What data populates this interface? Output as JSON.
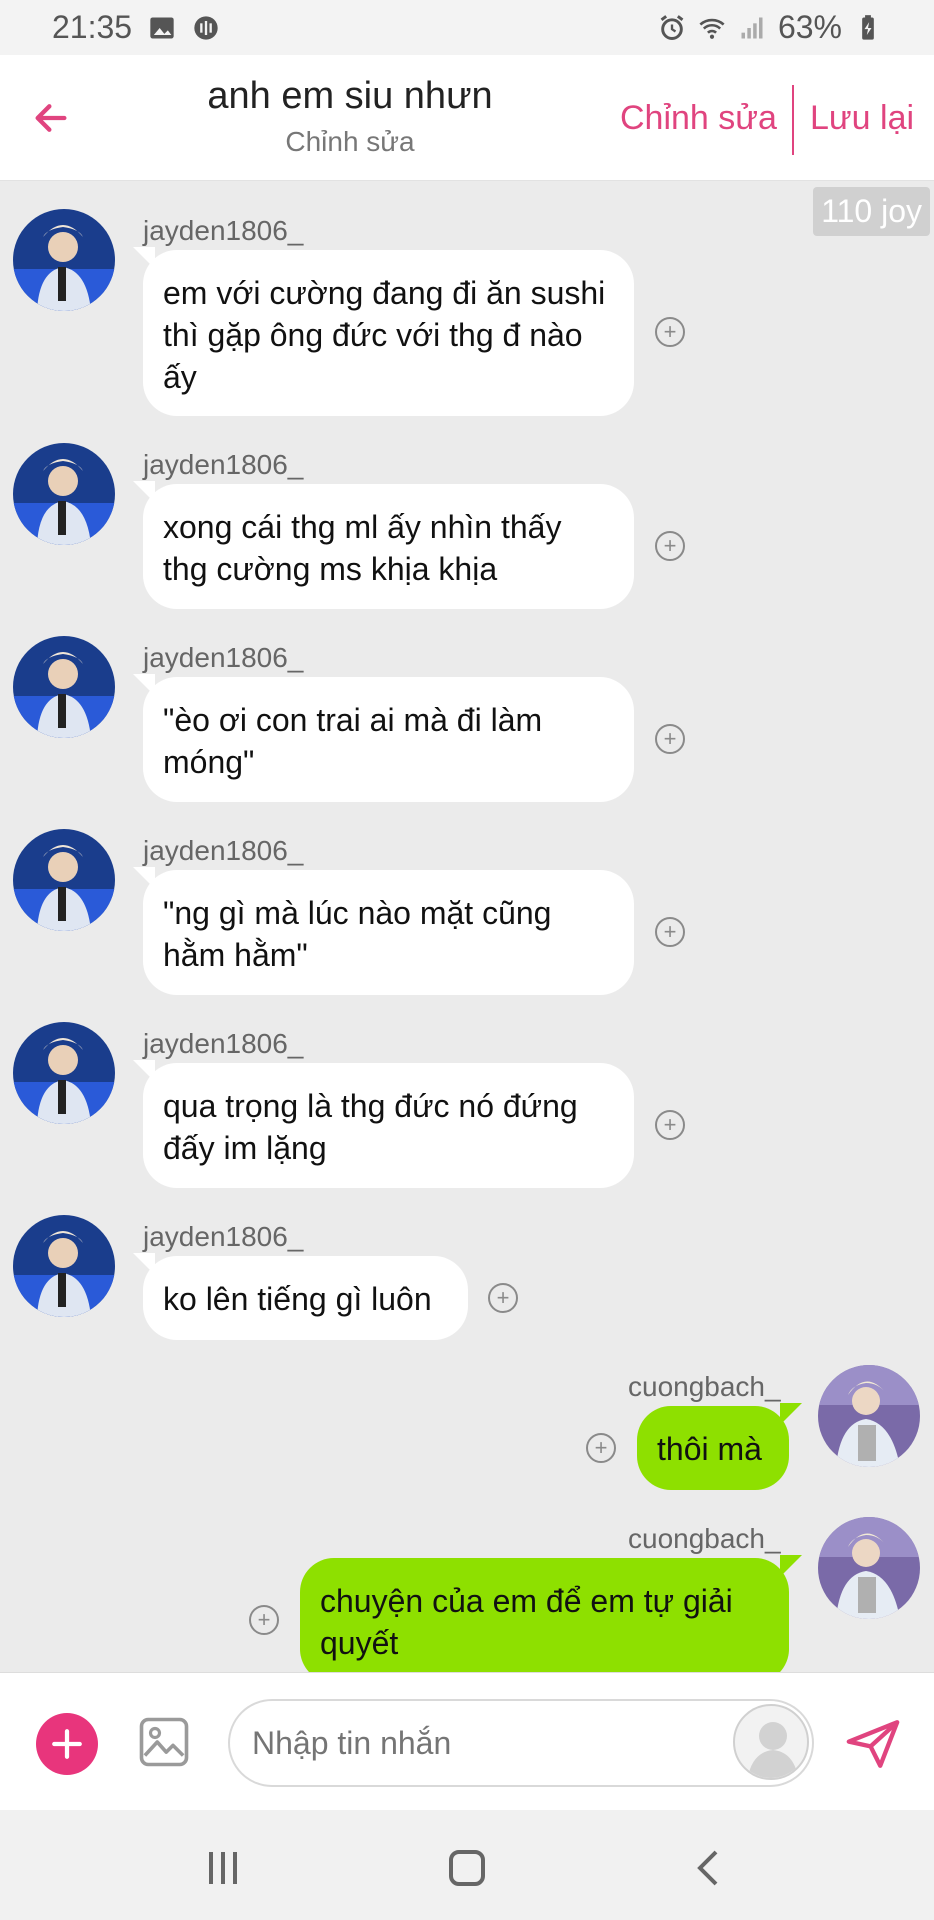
{
  "status_bar": {
    "time": "21:35",
    "battery": "63%"
  },
  "header": {
    "title": "anh em siu nhưn",
    "subtitle": "Chỉnh sửa",
    "edit_label": "Chỉnh sửa",
    "save_label": "Lưu lại"
  },
  "chat": {
    "joy_badge": "110 joy",
    "messages": [
      {
        "user": "jayden1806_",
        "text": "em với cường đang đi ăn sushi thì gặp ông đức với thg đ nào ấy",
        "side": "left"
      },
      {
        "user": "jayden1806_",
        "text": "xong cái thg ml ấy nhìn thấy thg cường ms khịa khịa",
        "side": "left"
      },
      {
        "user": "jayden1806_",
        "text": "\"èo ơi con trai ai mà đi làm móng\"",
        "side": "left"
      },
      {
        "user": "jayden1806_",
        "text": "\"ng gì mà lúc nào mặt cũng hằm hằm\"",
        "side": "left"
      },
      {
        "user": "jayden1806_",
        "text": "qua trọng là thg đức nó đứng đấy im lặng",
        "side": "left"
      },
      {
        "user": "jayden1806_",
        "text": "ko lên tiếng gì luôn",
        "side": "left"
      },
      {
        "user": "cuongbach_",
        "text": "thôi mà",
        "side": "right"
      },
      {
        "user": "cuongbach_",
        "text": "chuyện của em để em tự giải quyết",
        "side": "right"
      }
    ]
  },
  "composer": {
    "placeholder": "Nhập tin nhắn"
  },
  "colors": {
    "accent": "#e0447f",
    "own_bubble": "#8ee000",
    "other_bubble": "#ffffff",
    "background": "#ebebeb"
  }
}
